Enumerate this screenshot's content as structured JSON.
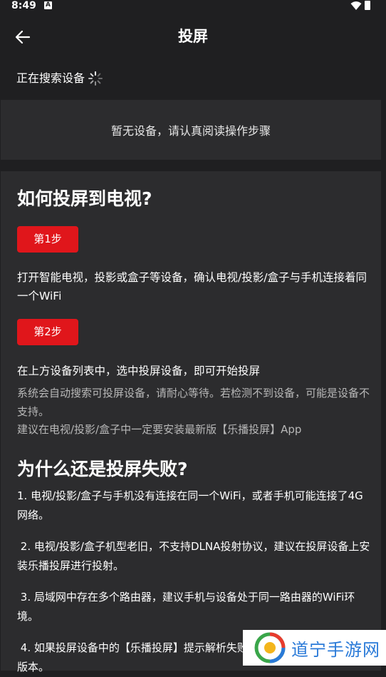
{
  "status_bar": {
    "time": "8:49",
    "notification_glyph": "A"
  },
  "header": {
    "title": "投屏",
    "back_icon": "arrow-left-icon"
  },
  "search": {
    "status_text": "正在搜索设备",
    "spinner_icon": "loading-spinner-icon"
  },
  "empty_state": {
    "text": "暂无设备，请认真阅读操作步骤"
  },
  "guide": {
    "heading": "如何投屏到电视?",
    "step1": {
      "label": "第1步",
      "text": "打开智能电视，投影或盒子等设备，确认电视/投影/盒子与手机连接着同一个WiFi"
    },
    "step2": {
      "label": "第2步",
      "text": "在上方设备列表中，选中投屏设备，即可开始投屏",
      "note1": "系统会自动搜索可投屏设备，请耐心等待。若检测不到设备，可能是设备不支持。",
      "note2": "建议在电视/投影/盒子中一定要安装最新版【乐播投屏】App"
    },
    "faq_heading": "为什么还是投屏失败?",
    "faq": [
      "1. 电视/投影/盒子与手机没有连接在同一个WiFi，或者手机可能连接了4G网络。",
      " 2. 电视/投影/盒子机型老旧，不支持DLNA投射协议，建议在投屏设备上安装乐播投屏进行投射。",
      " 3. 局域网中存在多个路由器，建议手机与设备处于同一路由器的WiFi环境。",
      " 4. 如果投屏设备中的【乐播投屏】提示解析失败，请升级投屏App为最新版本。"
    ]
  },
  "watermark": {
    "text": "道宁手游网"
  },
  "colors": {
    "accent_red": "#e0161b",
    "background": "#1f1f21",
    "panel": "#2c2c2e"
  }
}
